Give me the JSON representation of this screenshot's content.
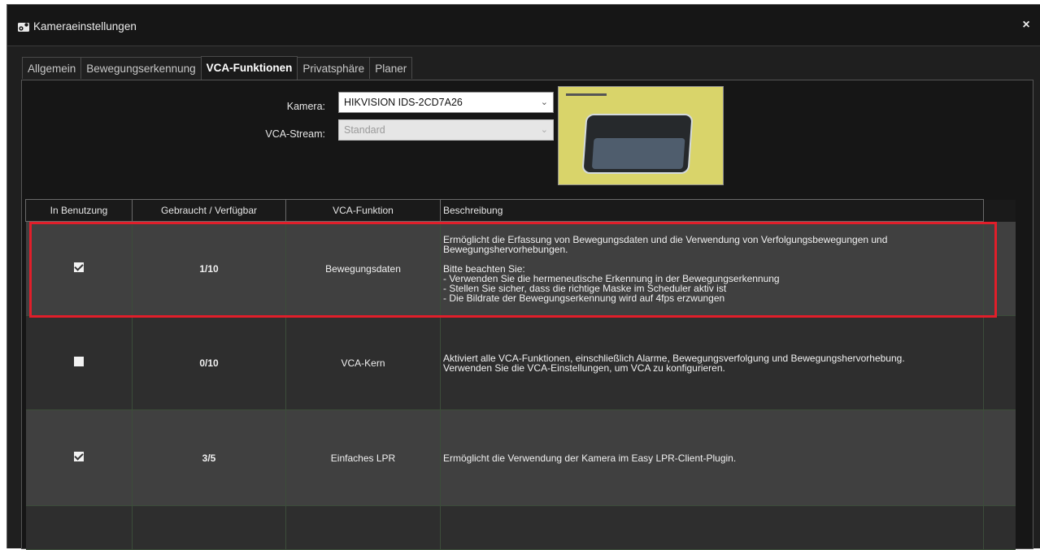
{
  "window": {
    "title": "Kameraeinstellungen",
    "close_label": "×"
  },
  "tabs": [
    {
      "label": "Allgemein",
      "active": false
    },
    {
      "label": "Bewegungserkennung",
      "active": false
    },
    {
      "label": "VCA-Funktionen",
      "active": true
    },
    {
      "label": "Privatsphäre",
      "active": false
    },
    {
      "label": "Planer",
      "active": false
    }
  ],
  "form": {
    "camera_label": "Kamera:",
    "camera_value": "HIKVISION IDS-2CD7A26",
    "stream_label": "VCA-Stream:",
    "stream_value": "Standard",
    "stream_disabled": true
  },
  "table": {
    "columns": [
      "In Benutzung",
      "Gebraucht / Verfügbar",
      "VCA-Funktion",
      "Beschreibung"
    ],
    "rows": [
      {
        "in_use": true,
        "usage": "1/10",
        "function": "Bewegungsdaten",
        "description": "Ermöglicht die Erfassung von Bewegungsdaten und die Verwendung von Verfolgungsbewegungen und\nBewegungshervorhebungen.\n\nBitte beachten Sie:\n- Verwenden Sie die hermeneutische Erkennung in der Bewegungserkennung\n- Stellen Sie sicher, dass die richtige Maske im Scheduler aktiv ist\n- Die Bildrate der Bewegungserkennung wird auf 4fps erzwungen",
        "highlighted": true
      },
      {
        "in_use": false,
        "usage": "0/10",
        "function": "VCA-Kern",
        "description": "Aktiviert alle VCA-Funktionen, einschließlich Alarme, Bewegungsverfolgung und Bewegungshervorhebung.\nVerwenden Sie die VCA-Einstellungen, um VCA zu konfigurieren."
      },
      {
        "in_use": true,
        "usage": "3/5",
        "function": "Einfaches LPR",
        "description": "Ermöglicht die Verwendung der Kamera im Easy LPR-Client-Plugin."
      },
      {
        "in_use": null,
        "usage": "",
        "function": "",
        "description": ""
      }
    ]
  },
  "colors": {
    "window_bg": "#1f1f1f",
    "row_light": "#404040",
    "row_dark": "#2e2e2e",
    "highlight_border": "#e11e2a"
  },
  "icons": {
    "title_icon": "camera-gear-icon",
    "dropdown": "chevron-down-icon",
    "close": "close-icon"
  }
}
